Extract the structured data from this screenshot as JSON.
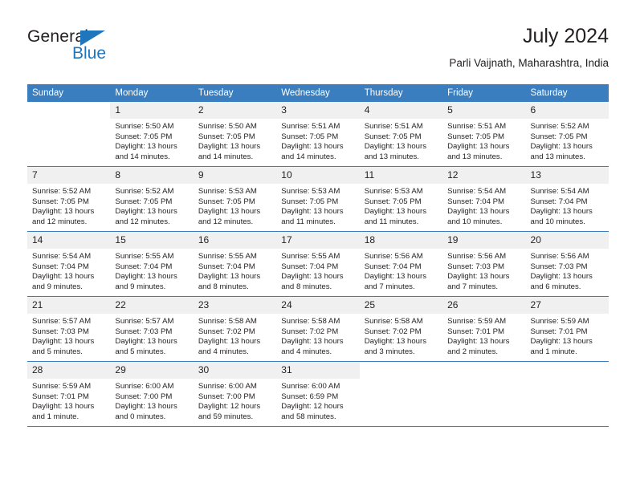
{
  "brand": {
    "name_top": "General",
    "name_bottom": "Blue",
    "triangle_color": "#1f76bc"
  },
  "header": {
    "title": "July 2024",
    "subtitle": "Parli Vaijnath, Maharashtra, India"
  },
  "theme": {
    "header_blue": "#3a7ec0",
    "daynum_band": "#f0f0f0",
    "text": "#231f20"
  },
  "weekdays": [
    "Sunday",
    "Monday",
    "Tuesday",
    "Wednesday",
    "Thursday",
    "Friday",
    "Saturday"
  ],
  "weeks": [
    [
      {
        "day": "",
        "lines": []
      },
      {
        "day": "1",
        "lines": [
          "Sunrise: 5:50 AM",
          "Sunset: 7:05 PM",
          "Daylight: 13 hours",
          "and 14 minutes."
        ]
      },
      {
        "day": "2",
        "lines": [
          "Sunrise: 5:50 AM",
          "Sunset: 7:05 PM",
          "Daylight: 13 hours",
          "and 14 minutes."
        ]
      },
      {
        "day": "3",
        "lines": [
          "Sunrise: 5:51 AM",
          "Sunset: 7:05 PM",
          "Daylight: 13 hours",
          "and 14 minutes."
        ]
      },
      {
        "day": "4",
        "lines": [
          "Sunrise: 5:51 AM",
          "Sunset: 7:05 PM",
          "Daylight: 13 hours",
          "and 13 minutes."
        ]
      },
      {
        "day": "5",
        "lines": [
          "Sunrise: 5:51 AM",
          "Sunset: 7:05 PM",
          "Daylight: 13 hours",
          "and 13 minutes."
        ]
      },
      {
        "day": "6",
        "lines": [
          "Sunrise: 5:52 AM",
          "Sunset: 7:05 PM",
          "Daylight: 13 hours",
          "and 13 minutes."
        ]
      }
    ],
    [
      {
        "day": "7",
        "lines": [
          "Sunrise: 5:52 AM",
          "Sunset: 7:05 PM",
          "Daylight: 13 hours",
          "and 12 minutes."
        ]
      },
      {
        "day": "8",
        "lines": [
          "Sunrise: 5:52 AM",
          "Sunset: 7:05 PM",
          "Daylight: 13 hours",
          "and 12 minutes."
        ]
      },
      {
        "day": "9",
        "lines": [
          "Sunrise: 5:53 AM",
          "Sunset: 7:05 PM",
          "Daylight: 13 hours",
          "and 12 minutes."
        ]
      },
      {
        "day": "10",
        "lines": [
          "Sunrise: 5:53 AM",
          "Sunset: 7:05 PM",
          "Daylight: 13 hours",
          "and 11 minutes."
        ]
      },
      {
        "day": "11",
        "lines": [
          "Sunrise: 5:53 AM",
          "Sunset: 7:05 PM",
          "Daylight: 13 hours",
          "and 11 minutes."
        ]
      },
      {
        "day": "12",
        "lines": [
          "Sunrise: 5:54 AM",
          "Sunset: 7:04 PM",
          "Daylight: 13 hours",
          "and 10 minutes."
        ]
      },
      {
        "day": "13",
        "lines": [
          "Sunrise: 5:54 AM",
          "Sunset: 7:04 PM",
          "Daylight: 13 hours",
          "and 10 minutes."
        ]
      }
    ],
    [
      {
        "day": "14",
        "lines": [
          "Sunrise: 5:54 AM",
          "Sunset: 7:04 PM",
          "Daylight: 13 hours",
          "and 9 minutes."
        ]
      },
      {
        "day": "15",
        "lines": [
          "Sunrise: 5:55 AM",
          "Sunset: 7:04 PM",
          "Daylight: 13 hours",
          "and 9 minutes."
        ]
      },
      {
        "day": "16",
        "lines": [
          "Sunrise: 5:55 AM",
          "Sunset: 7:04 PM",
          "Daylight: 13 hours",
          "and 8 minutes."
        ]
      },
      {
        "day": "17",
        "lines": [
          "Sunrise: 5:55 AM",
          "Sunset: 7:04 PM",
          "Daylight: 13 hours",
          "and 8 minutes."
        ]
      },
      {
        "day": "18",
        "lines": [
          "Sunrise: 5:56 AM",
          "Sunset: 7:04 PM",
          "Daylight: 13 hours",
          "and 7 minutes."
        ]
      },
      {
        "day": "19",
        "lines": [
          "Sunrise: 5:56 AM",
          "Sunset: 7:03 PM",
          "Daylight: 13 hours",
          "and 7 minutes."
        ]
      },
      {
        "day": "20",
        "lines": [
          "Sunrise: 5:56 AM",
          "Sunset: 7:03 PM",
          "Daylight: 13 hours",
          "and 6 minutes."
        ]
      }
    ],
    [
      {
        "day": "21",
        "lines": [
          "Sunrise: 5:57 AM",
          "Sunset: 7:03 PM",
          "Daylight: 13 hours",
          "and 5 minutes."
        ]
      },
      {
        "day": "22",
        "lines": [
          "Sunrise: 5:57 AM",
          "Sunset: 7:03 PM",
          "Daylight: 13 hours",
          "and 5 minutes."
        ]
      },
      {
        "day": "23",
        "lines": [
          "Sunrise: 5:58 AM",
          "Sunset: 7:02 PM",
          "Daylight: 13 hours",
          "and 4 minutes."
        ]
      },
      {
        "day": "24",
        "lines": [
          "Sunrise: 5:58 AM",
          "Sunset: 7:02 PM",
          "Daylight: 13 hours",
          "and 4 minutes."
        ]
      },
      {
        "day": "25",
        "lines": [
          "Sunrise: 5:58 AM",
          "Sunset: 7:02 PM",
          "Daylight: 13 hours",
          "and 3 minutes."
        ]
      },
      {
        "day": "26",
        "lines": [
          "Sunrise: 5:59 AM",
          "Sunset: 7:01 PM",
          "Daylight: 13 hours",
          "and 2 minutes."
        ]
      },
      {
        "day": "27",
        "lines": [
          "Sunrise: 5:59 AM",
          "Sunset: 7:01 PM",
          "Daylight: 13 hours",
          "and 1 minute."
        ]
      }
    ],
    [
      {
        "day": "28",
        "lines": [
          "Sunrise: 5:59 AM",
          "Sunset: 7:01 PM",
          "Daylight: 13 hours",
          "and 1 minute."
        ]
      },
      {
        "day": "29",
        "lines": [
          "Sunrise: 6:00 AM",
          "Sunset: 7:00 PM",
          "Daylight: 13 hours",
          "and 0 minutes."
        ]
      },
      {
        "day": "30",
        "lines": [
          "Sunrise: 6:00 AM",
          "Sunset: 7:00 PM",
          "Daylight: 12 hours",
          "and 59 minutes."
        ]
      },
      {
        "day": "31",
        "lines": [
          "Sunrise: 6:00 AM",
          "Sunset: 6:59 PM",
          "Daylight: 12 hours",
          "and 58 minutes."
        ]
      },
      {
        "day": "",
        "lines": []
      },
      {
        "day": "",
        "lines": []
      },
      {
        "day": "",
        "lines": []
      }
    ]
  ]
}
